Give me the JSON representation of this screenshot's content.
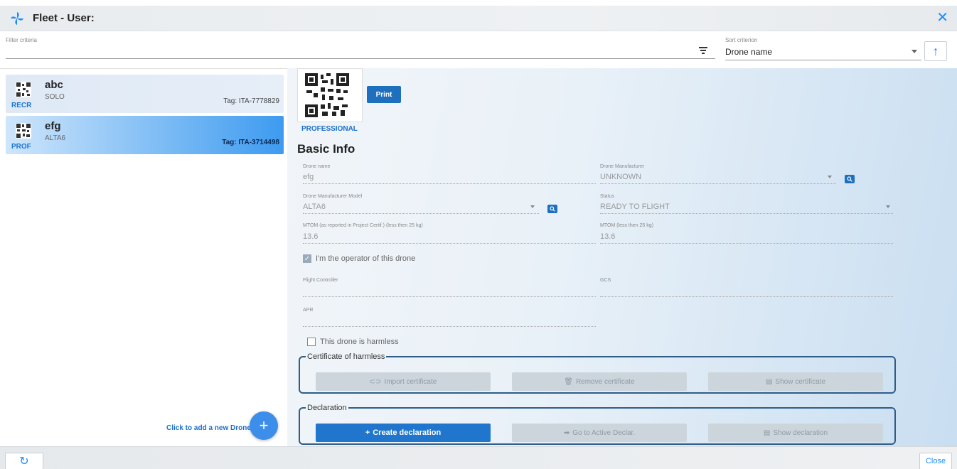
{
  "window": {
    "title": "Fleet - User:",
    "close_icon": "close-x-icon"
  },
  "filter": {
    "label": "Filter criteria",
    "value": "",
    "icon": "filter-lines-icon"
  },
  "sort": {
    "label": "Sort criterion",
    "value": "Drone name",
    "direction_icon": "arrow-up-icon"
  },
  "drones": [
    {
      "name": "abc",
      "model": "SOLO",
      "kind": "RECR",
      "tag": "Tag: ITA-7778829",
      "selected": false
    },
    {
      "name": "efg",
      "model": "ALTA6",
      "kind": "PROF",
      "tag": "Tag: ITA-3714498",
      "selected": true
    }
  ],
  "add_drone": {
    "label": "Click to add a new Drone.",
    "button": "+"
  },
  "detail": {
    "print_label": "Print",
    "category": "PROFESSIONAL",
    "section_title": "Basic Info",
    "drone_name": {
      "label": "Drone name",
      "value": "efg"
    },
    "manufacturer": {
      "label": "Drone Manufacturer",
      "value": "UNKNOWN"
    },
    "model": {
      "label": "Drone Manufacturer Model",
      "value": "ALTA6"
    },
    "status": {
      "label": "Status",
      "value": "READY TO FLIGHT"
    },
    "mtom_cert": {
      "label": "MTOM (as reported in Project Certif.) (less then 25 kg)",
      "value": "13.6"
    },
    "mtom": {
      "label": "MTOM (less then 25 kg)",
      "value": "13.6"
    },
    "operator_check": {
      "label": "I'm the operator of this drone",
      "checked": true
    },
    "flight_controller": {
      "label": "Flight Controller",
      "value": ""
    },
    "gcs": {
      "label": "GCS",
      "value": ""
    },
    "apr": {
      "label": "APR",
      "value": ""
    },
    "harmless_check": {
      "label": "This drone is harmless",
      "checked": false
    },
    "certificate_group": {
      "legend": "Certificate of harmless",
      "import": "Import certificate",
      "remove": "Remove certificate",
      "show": "Show certificate"
    },
    "declaration_group": {
      "legend": "Declaration",
      "create": "Create declaration",
      "goto": "Go to Active Declar.",
      "show": "Show declaration"
    }
  },
  "footer": {
    "refresh_icon": "refresh-icon",
    "close_label": "Close"
  },
  "colors": {
    "accent": "#1a8cff",
    "primary_button": "#1f76cc",
    "group_border": "#2f5d87"
  }
}
